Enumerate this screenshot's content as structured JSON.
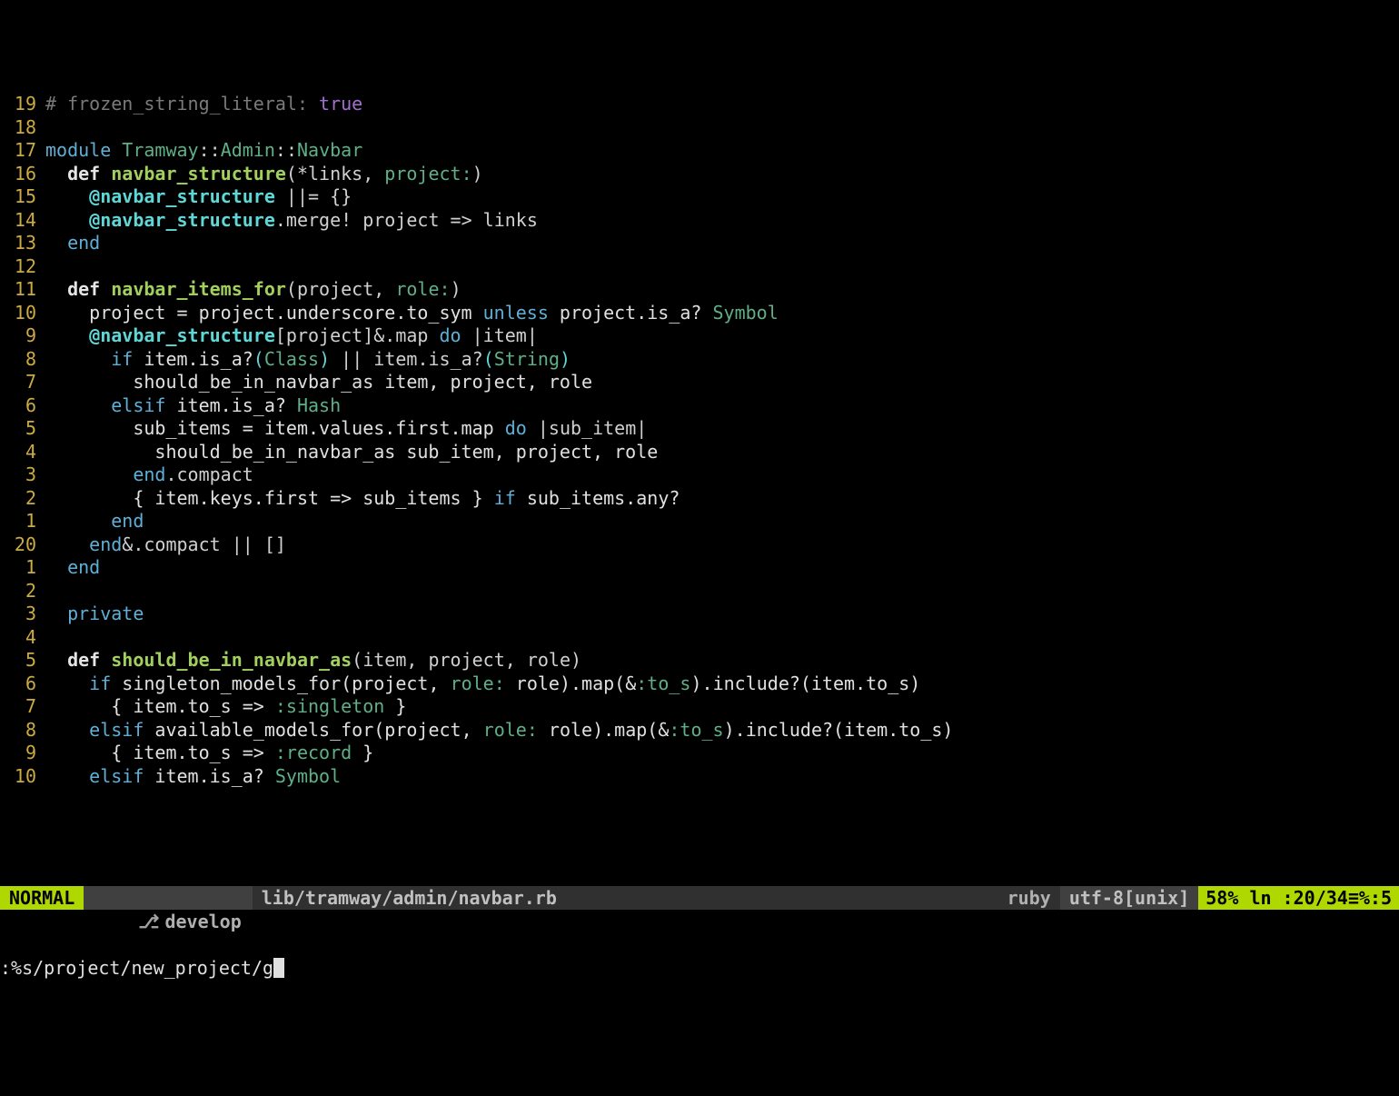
{
  "lines": [
    {
      "num": "19",
      "tokens": [
        [
          "c-comment",
          "# frozen_string_literal: "
        ],
        [
          "c-bool",
          "true"
        ]
      ]
    },
    {
      "num": "18",
      "tokens": []
    },
    {
      "num": "17",
      "tokens": [
        [
          "c-kw",
          "module "
        ],
        [
          "c-tramway",
          "Tramway"
        ],
        [
          "c-op",
          "::"
        ],
        [
          "c-tramway",
          "Admin"
        ],
        [
          "c-op",
          "::"
        ],
        [
          "c-tramway",
          "Navbar"
        ]
      ]
    },
    {
      "num": "16",
      "tokens": [
        [
          "c-id",
          "  "
        ],
        [
          "c-def",
          "def "
        ],
        [
          "c-defname",
          "navbar_structure"
        ],
        [
          "c-op",
          "(*links, "
        ],
        [
          "c-param",
          "project:"
        ],
        [
          "c-op",
          ")"
        ]
      ]
    },
    {
      "num": "15",
      "tokens": [
        [
          "c-id",
          "    "
        ],
        [
          "c-ivar",
          "@navbar_structure"
        ],
        [
          "c-op",
          " ||= {}"
        ]
      ]
    },
    {
      "num": "14",
      "tokens": [
        [
          "c-id",
          "    "
        ],
        [
          "c-ivar",
          "@navbar_structure"
        ],
        [
          "c-op",
          ".merge! project => links"
        ]
      ]
    },
    {
      "num": "13",
      "tokens": [
        [
          "c-id",
          "  "
        ],
        [
          "c-kw",
          "end"
        ]
      ]
    },
    {
      "num": "12",
      "tokens": []
    },
    {
      "num": "11",
      "tokens": [
        [
          "c-id",
          "  "
        ],
        [
          "c-def",
          "def "
        ],
        [
          "c-defname",
          "navbar_items_for"
        ],
        [
          "c-op",
          "(project, "
        ],
        [
          "c-param",
          "role:"
        ],
        [
          "c-op",
          ")"
        ]
      ]
    },
    {
      "num": "10",
      "tokens": [
        [
          "c-id",
          "    project = project.underscore.to_sym "
        ],
        [
          "c-kw",
          "unless"
        ],
        [
          "c-id",
          " project.is_a? "
        ],
        [
          "c-class",
          "Symbol"
        ]
      ]
    },
    {
      "num": "9",
      "tokens": [
        [
          "c-id",
          "    "
        ],
        [
          "c-ivar",
          "@navbar_structure"
        ],
        [
          "c-op",
          "[project]&.map "
        ],
        [
          "c-kw",
          "do"
        ],
        [
          "c-op",
          " |item|"
        ]
      ]
    },
    {
      "num": "8",
      "tokens": [
        [
          "c-id",
          "      "
        ],
        [
          "c-kw",
          "if"
        ],
        [
          "c-id",
          " item.is_a?"
        ],
        [
          "c-paren",
          "("
        ],
        [
          "c-class",
          "Class"
        ],
        [
          "c-paren",
          ")"
        ],
        [
          "c-op",
          " || item.is_a?"
        ],
        [
          "c-paren",
          "("
        ],
        [
          "c-class",
          "String"
        ],
        [
          "c-paren",
          ")"
        ]
      ]
    },
    {
      "num": "7",
      "tokens": [
        [
          "c-id",
          "        should_be_in_navbar_as item, project, role"
        ]
      ]
    },
    {
      "num": "6",
      "tokens": [
        [
          "c-id",
          "      "
        ],
        [
          "c-kw",
          "elsif"
        ],
        [
          "c-id",
          " item.is_a? "
        ],
        [
          "c-class",
          "Hash"
        ]
      ]
    },
    {
      "num": "5",
      "tokens": [
        [
          "c-id",
          "        sub_items = item.values.first.map "
        ],
        [
          "c-kw",
          "do"
        ],
        [
          "c-op",
          " |sub_item|"
        ]
      ]
    },
    {
      "num": "4",
      "tokens": [
        [
          "c-id",
          "          should_be_in_navbar_as sub_item, project, role"
        ]
      ]
    },
    {
      "num": "3",
      "tokens": [
        [
          "c-id",
          "        "
        ],
        [
          "c-kw",
          "end"
        ],
        [
          "c-op",
          ".compact"
        ]
      ]
    },
    {
      "num": "2",
      "tokens": [
        [
          "c-id",
          "        { item.keys.first => sub_items } "
        ],
        [
          "c-kw",
          "if"
        ],
        [
          "c-id",
          " sub_items.any?"
        ]
      ]
    },
    {
      "num": "1",
      "tokens": [
        [
          "c-id",
          "      "
        ],
        [
          "c-kw",
          "end"
        ]
      ]
    },
    {
      "num": "20",
      "tokens": [
        [
          "c-id",
          "    "
        ],
        [
          "c-kw",
          "end"
        ],
        [
          "c-op",
          "&.compact || []"
        ]
      ]
    },
    {
      "num": "1",
      "tokens": [
        [
          "c-id",
          "  "
        ],
        [
          "c-kw",
          "end"
        ]
      ]
    },
    {
      "num": "2",
      "tokens": []
    },
    {
      "num": "3",
      "tokens": [
        [
          "c-id",
          "  "
        ],
        [
          "c-kw",
          "private"
        ]
      ]
    },
    {
      "num": "4",
      "tokens": []
    },
    {
      "num": "5",
      "tokens": [
        [
          "c-id",
          "  "
        ],
        [
          "c-def",
          "def "
        ],
        [
          "c-defname",
          "should_be_in_navbar_as"
        ],
        [
          "c-op",
          "(item, project, role)"
        ]
      ]
    },
    {
      "num": "6",
      "tokens": [
        [
          "c-id",
          "    "
        ],
        [
          "c-kw",
          "if"
        ],
        [
          "c-id",
          " singleton_models_for(project, "
        ],
        [
          "c-param",
          "role:"
        ],
        [
          "c-id",
          " role).map(&"
        ],
        [
          "c-sym",
          ":to_s"
        ],
        [
          "c-id",
          ").include?(item.to_s)"
        ]
      ]
    },
    {
      "num": "7",
      "tokens": [
        [
          "c-id",
          "      { item.to_s => "
        ],
        [
          "c-sym",
          ":singleton"
        ],
        [
          "c-id",
          " }"
        ]
      ]
    },
    {
      "num": "8",
      "tokens": [
        [
          "c-id",
          "    "
        ],
        [
          "c-kw",
          "elsif"
        ],
        [
          "c-id",
          " available_models_for(project, "
        ],
        [
          "c-param",
          "role:"
        ],
        [
          "c-id",
          " role).map(&"
        ],
        [
          "c-sym",
          ":to_s"
        ],
        [
          "c-id",
          ").include?(item.to_s)"
        ]
      ]
    },
    {
      "num": "9",
      "tokens": [
        [
          "c-id",
          "      { item.to_s => "
        ],
        [
          "c-sym",
          ":record"
        ],
        [
          "c-id",
          " }"
        ]
      ]
    },
    {
      "num": "10",
      "tokens": [
        [
          "c-id",
          "    "
        ],
        [
          "c-kw",
          "elsif"
        ],
        [
          "c-id",
          " item.is_a? "
        ],
        [
          "c-class",
          "Symbol"
        ]
      ]
    }
  ],
  "status": {
    "mode": "NORMAL",
    "branch": "develop",
    "file": "lib/tramway/admin/navbar.rb",
    "filetype": "ruby",
    "encoding": "utf-8[unix]",
    "percent": "58%",
    "ln_label": "ln :",
    "ln": "20",
    "ln_sep": "/34",
    "col_sep": "≡%:",
    "col": "5"
  },
  "commandline": ":%s/project/new_project/g"
}
